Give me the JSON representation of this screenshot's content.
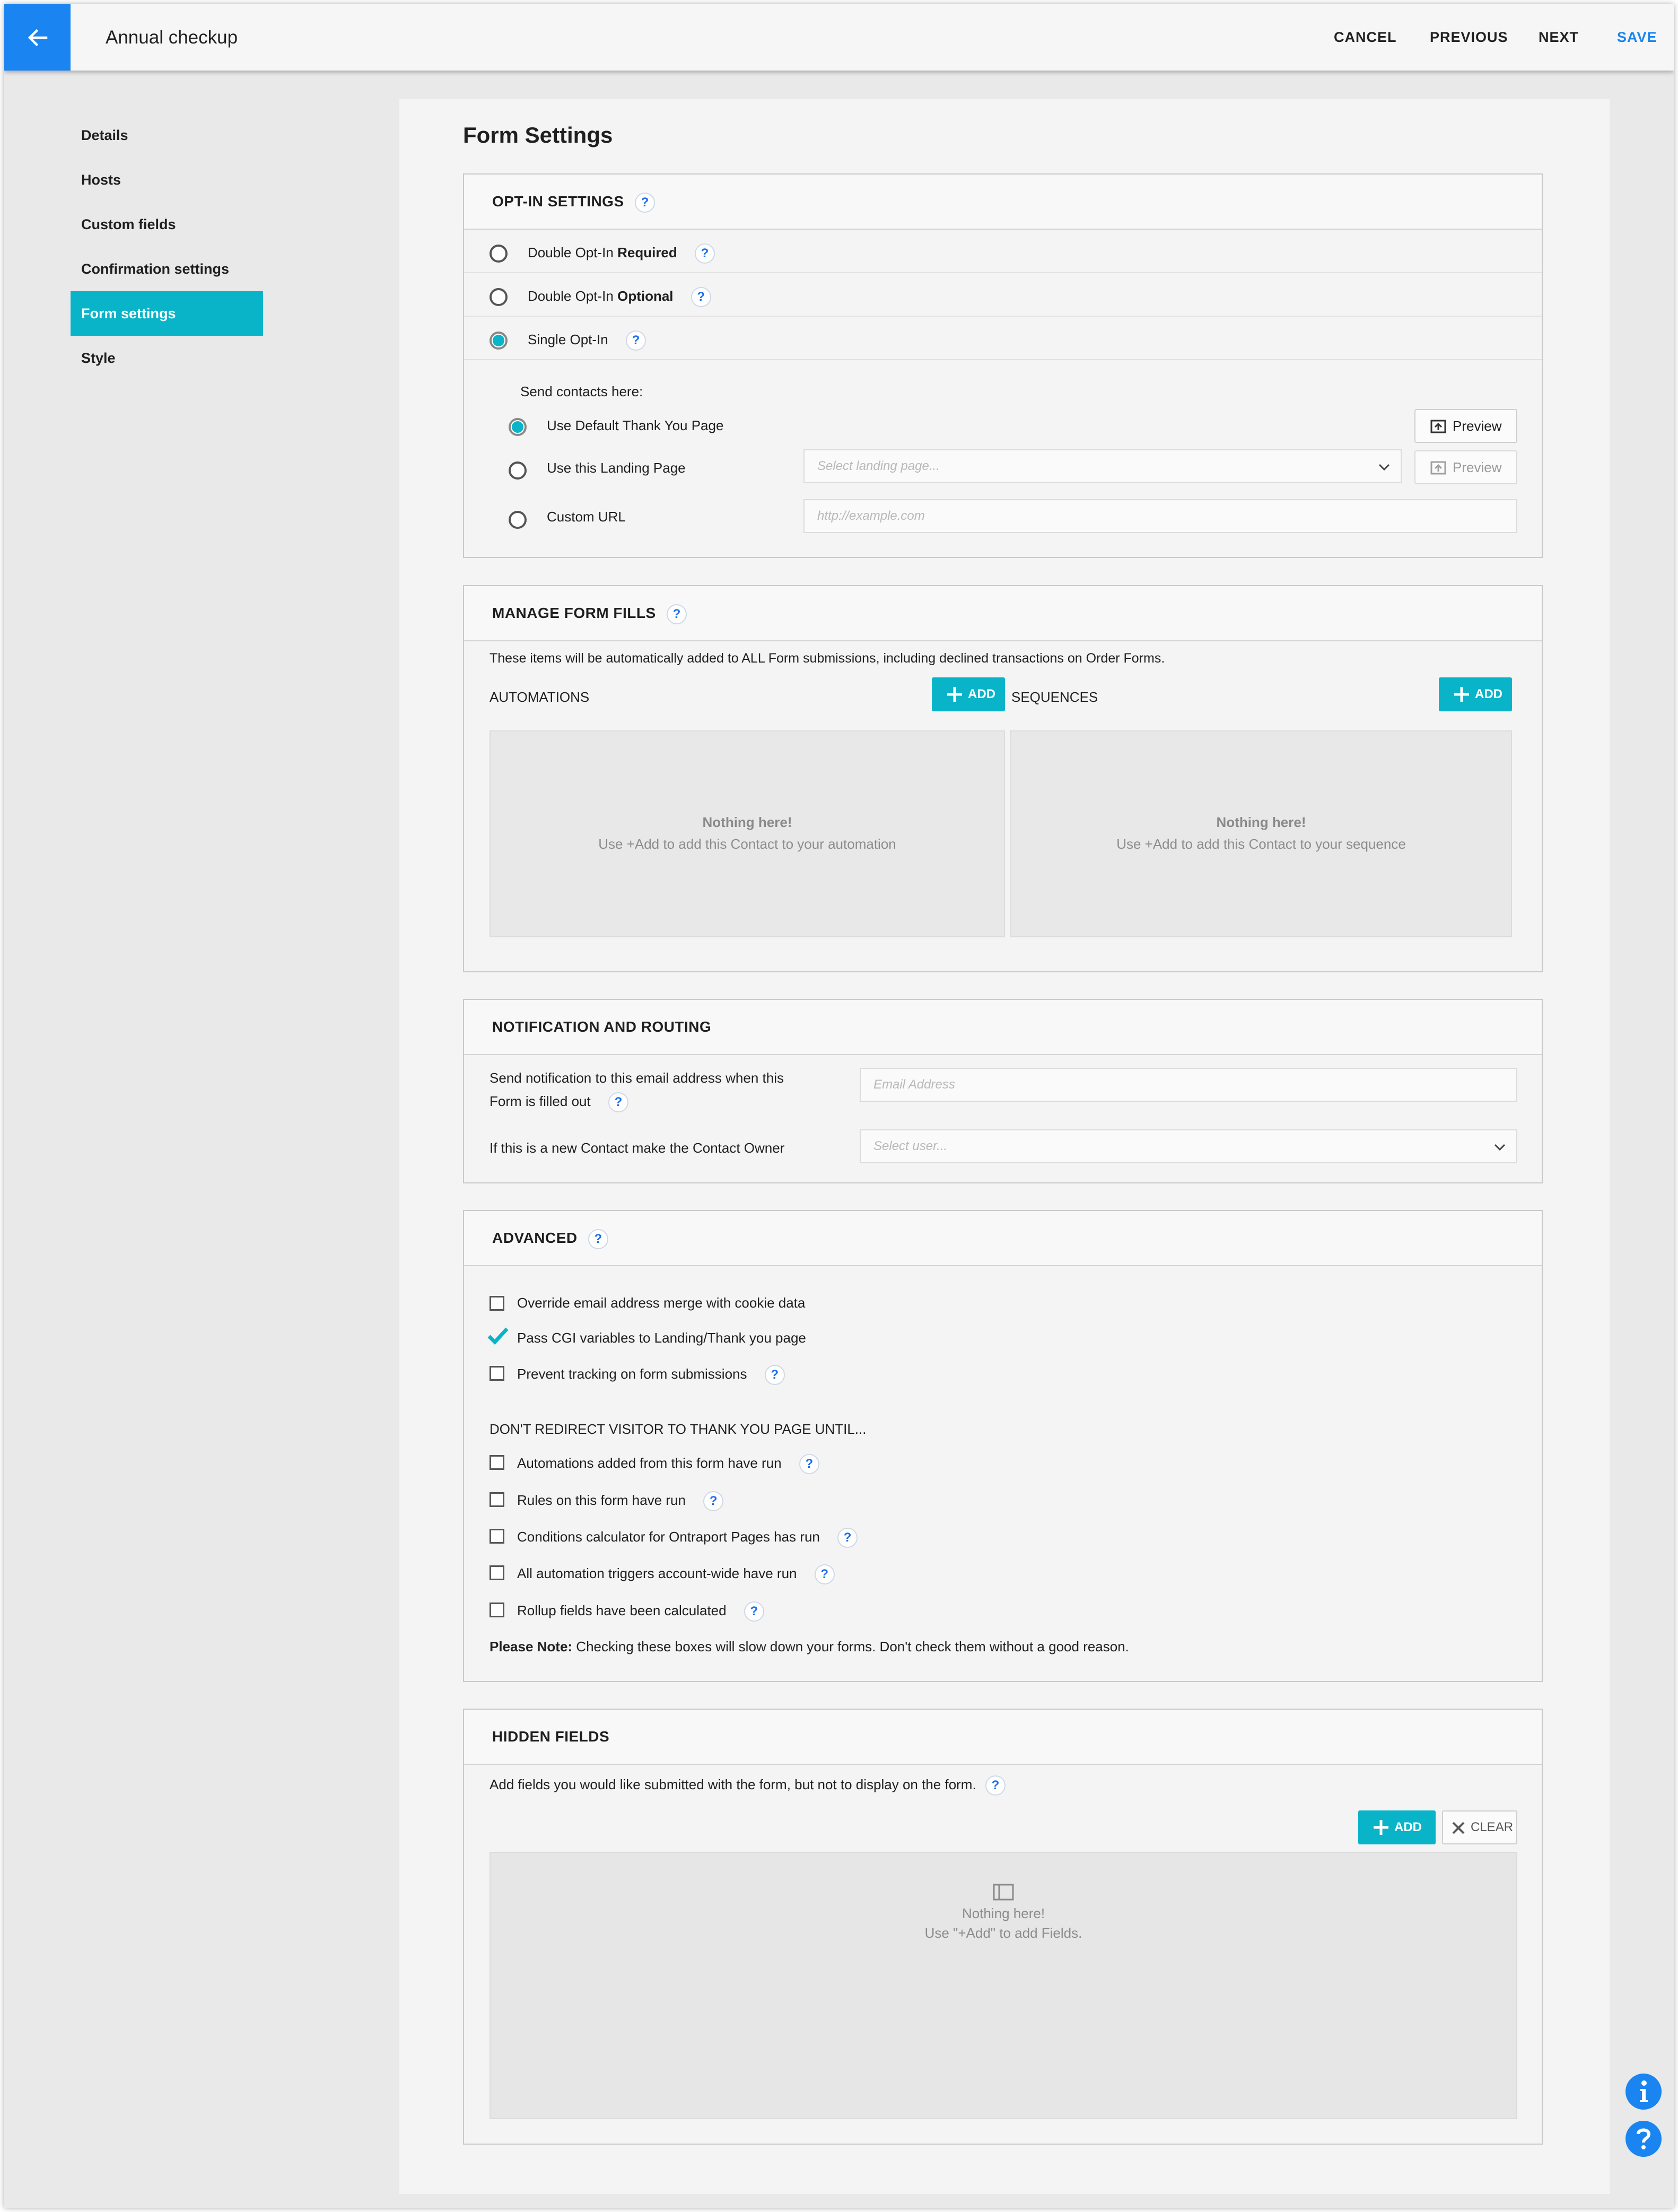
{
  "header": {
    "title": "Annual checkup",
    "actions": {
      "cancel": "CANCEL",
      "previous": "PREVIOUS",
      "next": "NEXT",
      "save": "SAVE"
    }
  },
  "sidebar": {
    "items": [
      {
        "label": "Details"
      },
      {
        "label": "Hosts"
      },
      {
        "label": "Custom fields"
      },
      {
        "label": "Confirmation settings"
      },
      {
        "label": "Form settings",
        "active": true
      },
      {
        "label": "Style"
      }
    ]
  },
  "main": {
    "heading": "Form Settings",
    "optin": {
      "title": "OPT-IN SETTINGS",
      "options": [
        {
          "prefix": "Double Opt-In ",
          "strong": "Required",
          "selected": false
        },
        {
          "prefix": "Double Opt-In ",
          "strong": "Optional",
          "selected": false
        },
        {
          "prefix": "Single Opt-In",
          "strong": "",
          "selected": true
        }
      ],
      "send_label": "Send contacts here:",
      "destinations": [
        {
          "label": "Use Default Thank You Page",
          "selected": true
        },
        {
          "label": "Use this Landing Page",
          "selected": false,
          "placeholder": "Select landing page..."
        },
        {
          "label": "Custom URL",
          "selected": false,
          "placeholder": "http://example.com"
        }
      ],
      "preview_label": "Preview"
    },
    "form_fills": {
      "title": "MANAGE FORM FILLS",
      "description": "These items will be automatically added to ALL Form submissions, including declined transactions on Order Forms.",
      "automations_label": "AUTOMATIONS",
      "sequences_label": "SEQUENCES",
      "add_label": "ADD",
      "empty_title": "Nothing here!",
      "automations_empty": "Use +Add to add this Contact to your automation",
      "sequences_empty": "Use +Add to add this Contact to your sequence"
    },
    "notification": {
      "title": "NOTIFICATION AND ROUTING",
      "email_label_1": "Send notification to this email address when this",
      "email_label_2": "Form is filled out",
      "email_placeholder": "Email Address",
      "owner_label": "If this is a new Contact make the Contact Owner",
      "owner_placeholder": "Select user..."
    },
    "advanced": {
      "title": "ADVANCED",
      "options": [
        {
          "label": "Override email address merge with cookie data",
          "checked": false
        },
        {
          "label": "Pass CGI variables to Landing/Thank you page",
          "checked": true
        },
        {
          "label": "Prevent tracking on form submissions",
          "checked": false
        }
      ],
      "redirect_heading": "DON'T REDIRECT VISITOR TO THANK YOU PAGE UNTIL...",
      "redirect_options": [
        {
          "label": "Automations added from this form have run",
          "checked": false
        },
        {
          "label": "Rules on this form have run",
          "checked": false
        },
        {
          "label": "Conditions calculator for Ontraport Pages has run",
          "checked": false
        },
        {
          "label": "All automation triggers account-wide have run",
          "checked": false
        },
        {
          "label": "Rollup fields have been calculated",
          "checked": false
        }
      ],
      "note_label": "Please Note:",
      "note_text": " Checking these boxes will slow down your forms. Don't check them without a good reason."
    },
    "hidden_fields": {
      "title": "HIDDEN FIELDS",
      "description": "Add fields you would like submitted with the form, but not to display on the form.",
      "add_label": "ADD",
      "clear_label": "CLEAR",
      "empty_title": "Nothing here!",
      "empty_text": "Use \"+Add\" to add Fields."
    }
  },
  "colors": {
    "accent": "#09b4c9",
    "brand_blue": "#1a85f0",
    "help_blue": "#1a6ef0"
  },
  "icons": [
    "arrow-left-icon",
    "help-icon",
    "chevron-down-icon",
    "preview-icon",
    "plus-icon",
    "close-icon",
    "checkmark-icon",
    "window-icon",
    "info-icon",
    "question-icon"
  ]
}
